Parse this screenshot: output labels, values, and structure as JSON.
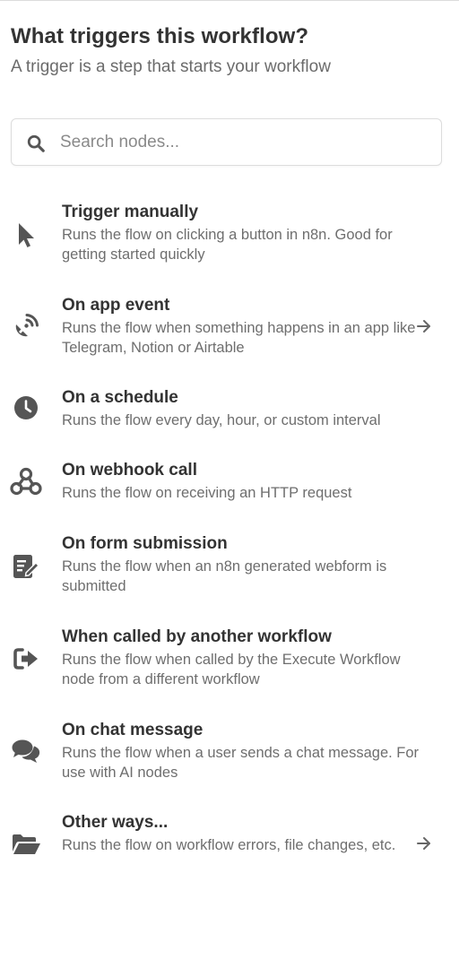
{
  "header": {
    "title": "What triggers this workflow?",
    "subtitle": "A trigger is a step that starts your workflow"
  },
  "search": {
    "placeholder": "Search nodes..."
  },
  "triggers": [
    {
      "label": "Trigger manually",
      "description": "Runs the flow on clicking a button in n8n. Good for getting started quickly",
      "icon": "cursor-pointer-icon",
      "has_arrow": false
    },
    {
      "label": "On app event",
      "description": "Runs the flow when something happens in an app like Telegram, Notion or Airtable",
      "icon": "satellite-dish-icon",
      "has_arrow": true
    },
    {
      "label": "On a schedule",
      "description": "Runs the flow every day, hour, or custom interval",
      "icon": "clock-icon",
      "has_arrow": false
    },
    {
      "label": "On webhook call",
      "description": "Runs the flow on receiving an HTTP request",
      "icon": "webhook-icon",
      "has_arrow": false
    },
    {
      "label": "On form submission",
      "description": "Runs the flow when an n8n generated webform is submitted",
      "icon": "form-edit-icon",
      "has_arrow": false
    },
    {
      "label": "When called by another workflow",
      "description": "Runs the flow when called by the Execute Workflow node from a different workflow",
      "icon": "sign-out-icon",
      "has_arrow": false
    },
    {
      "label": "On chat message",
      "description": "Runs the flow when a user sends a chat message. For use with AI nodes",
      "icon": "chat-bubbles-icon",
      "has_arrow": false
    },
    {
      "label": "Other ways...",
      "description": "Runs the flow on workflow errors, file changes, etc.",
      "icon": "folder-open-icon",
      "has_arrow": true
    }
  ],
  "colors": {
    "icon": "#555555",
    "title": "#333333",
    "description": "#6e6e6e",
    "border": "#dddddd"
  }
}
